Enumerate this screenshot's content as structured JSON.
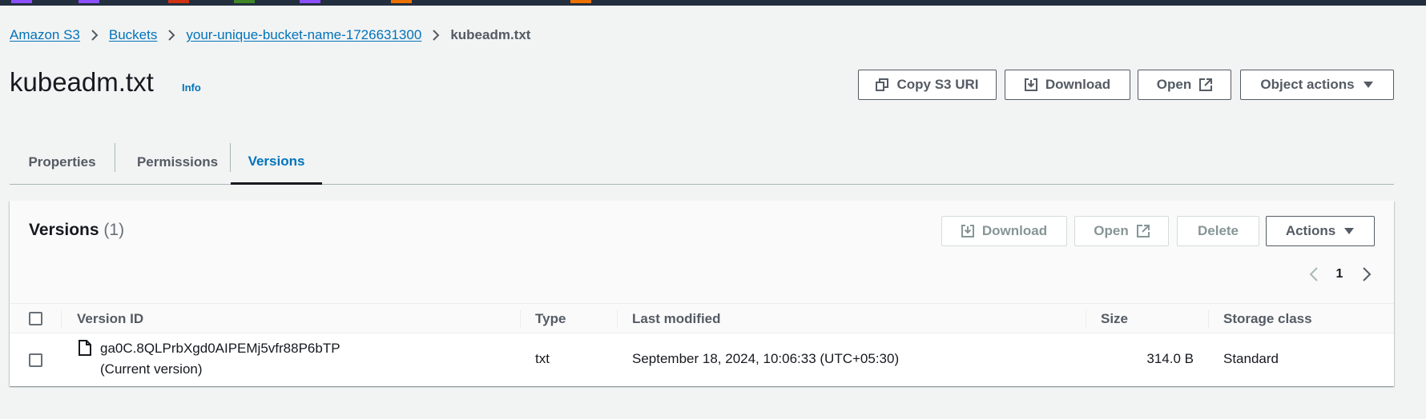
{
  "colors": {
    "topbar": "#232f3e",
    "link": "#0073bb",
    "text": "#16191f",
    "muted": "#545b64",
    "disabled": "#879596",
    "background": "#f2f3f3",
    "top_chips": [
      "#8c4fff",
      "#8c4fff",
      "#d13212",
      "#3f8624",
      "#8c4fff",
      "#ed7100",
      "#ed7100"
    ]
  },
  "breadcrumb": {
    "items": [
      "Amazon S3",
      "Buckets",
      "your-unique-bucket-name-1726631300"
    ],
    "current": "kubeadm.txt",
    "separator_icon": "chevron-right-icon"
  },
  "header": {
    "title": "kubeadm.txt",
    "info": "Info",
    "buttons": {
      "copy_uri": "Copy S3 URI",
      "download": "Download",
      "open": "Open",
      "object_actions": "Object actions"
    }
  },
  "tabs": [
    {
      "label": "Properties",
      "active": false
    },
    {
      "label": "Permissions",
      "active": false
    },
    {
      "label": "Versions",
      "active": true
    }
  ],
  "versions_panel": {
    "title": "Versions",
    "count": "(1)",
    "buttons": {
      "download": "Download",
      "open": "Open",
      "delete": "Delete",
      "actions": "Actions"
    },
    "pagination": {
      "current_page": "1"
    },
    "columns": [
      "Version ID",
      "Type",
      "Last modified",
      "Size",
      "Storage class"
    ],
    "rows": [
      {
        "version_id": "ga0C.8QLPrbXgd0AIPEMj5vfr88P6bTP",
        "version_note": "(Current version)",
        "type": "txt",
        "last_modified": "September 18, 2024, 10:06:33 (UTC+05:30)",
        "size": "314.0 B",
        "storage_class": "Standard",
        "selected": false
      }
    ]
  }
}
